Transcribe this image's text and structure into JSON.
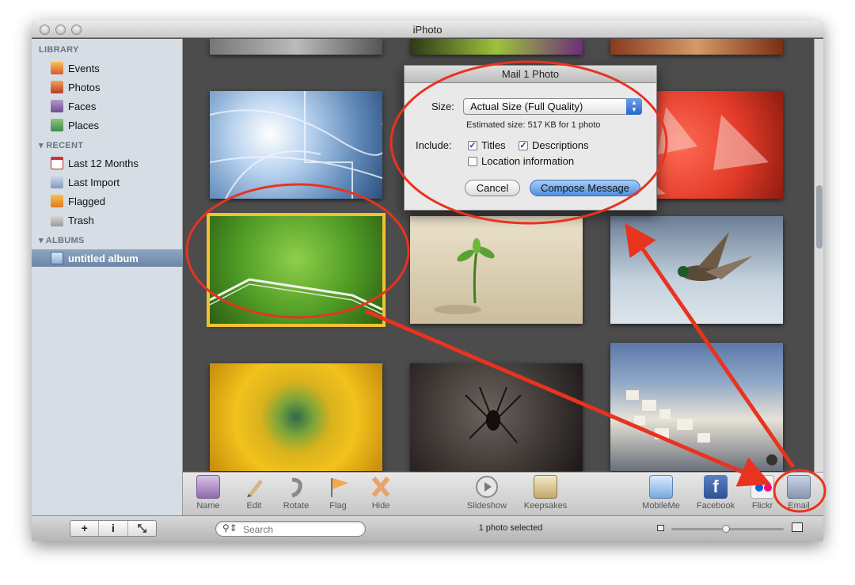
{
  "window": {
    "title": "iPhoto"
  },
  "sidebar": {
    "sections": [
      {
        "header": "LIBRARY",
        "items": [
          "Events",
          "Photos",
          "Faces",
          "Places"
        ]
      },
      {
        "header": "RECENT",
        "items": [
          "Last 12 Months",
          "Last Import",
          "Flagged",
          "Trash"
        ]
      },
      {
        "header": "ALBUMS",
        "items": [
          "untitled album"
        ]
      }
    ],
    "selected": "untitled album"
  },
  "dialog": {
    "title": "Mail 1 Photo",
    "size_label": "Size:",
    "size_value": "Actual Size (Full Quality)",
    "estimate": "Estimated size: 517 KB for 1 photo",
    "include_label": "Include:",
    "titles_label": "Titles",
    "titles_checked": true,
    "descriptions_label": "Descriptions",
    "descriptions_checked": true,
    "location_label": "Location information",
    "location_checked": false,
    "cancel_label": "Cancel",
    "compose_label": "Compose Message"
  },
  "toolbar": {
    "name_label": "Name",
    "edit_label": "Edit",
    "rotate_label": "Rotate",
    "flag_label": "Flag",
    "hide_label": "Hide",
    "slideshow_label": "Slideshow",
    "keepsakes_label": "Keepsakes",
    "mobileme_label": "MobileMe",
    "facebook_label": "Facebook",
    "flickr_label": "Flickr",
    "email_label": "Email"
  },
  "bottombar": {
    "add_symbol": "+",
    "info_symbol": "i",
    "search_placeholder": "Search",
    "status": "1 photo selected"
  },
  "colors": {
    "selection": "#f2c230",
    "annotation": "#e8331f",
    "sidebar_selected": "#7a90ae"
  }
}
